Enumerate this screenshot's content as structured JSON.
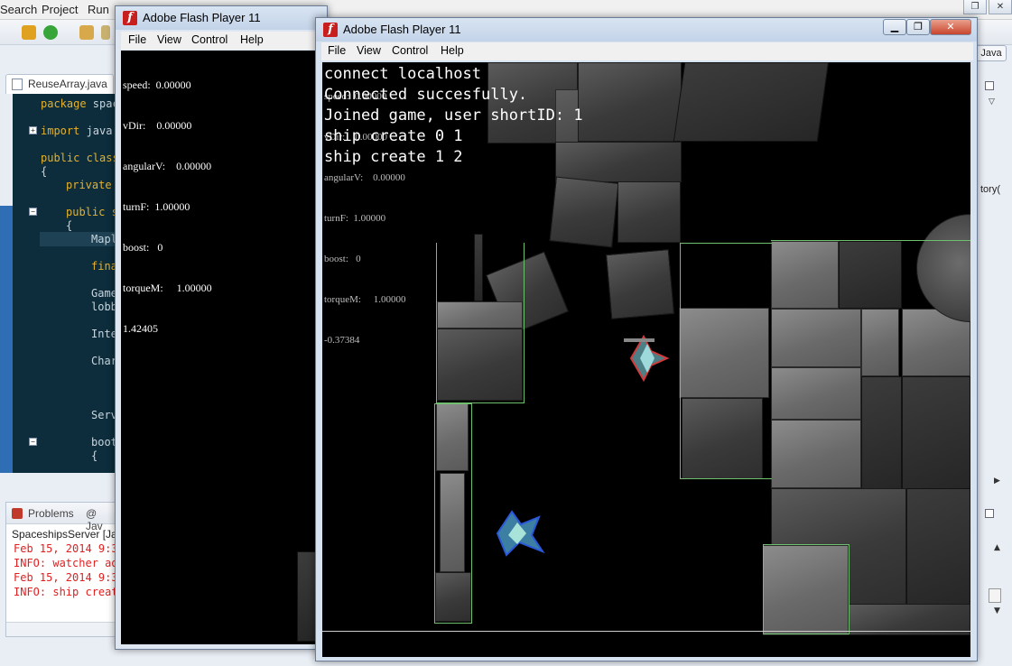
{
  "ide": {
    "menu": [
      "Search",
      "Project",
      "Run"
    ],
    "editor_tab": "ReuseArray.java",
    "perspective": "Java",
    "code_lines": [
      {
        "kw": "package",
        "text": " spac"
      },
      {
        "kw": "import",
        "text": " java."
      },
      {
        "kw": "public class",
        "text": ""
      },
      {
        "kw": "",
        "text": "{"
      },
      {
        "kw": "private",
        "text": ""
      },
      {
        "kw": "public s",
        "text": ""
      },
      {
        "kw": "",
        "text": "{"
      },
      {
        "kw": "",
        "text": "Mapl"
      },
      {
        "kw": "fina",
        "text": ""
      },
      {
        "kw": "",
        "text": "Game"
      },
      {
        "kw": "",
        "text": "lobb"
      },
      {
        "kw": "",
        "text": "Inte"
      },
      {
        "kw": "",
        "text": "Char"
      },
      {
        "kw": "",
        "text": "Serv"
      },
      {
        "kw": "",
        "text": "boot"
      },
      {
        "kw": "",
        "text": "{"
      }
    ],
    "console_tabs": [
      "Problems",
      "@ Jav"
    ],
    "console_title": "SpaceshipsServer [Jav",
    "console_lines": [
      "Feb 15, 2014 9:3",
      "INFO: watcher ad",
      "Feb 15, 2014 9:3",
      "INFO: ship creat"
    ],
    "right_fragment": "tory("
  },
  "flash_back": {
    "title": "Adobe Flash Player 11",
    "menu": [
      "File",
      "View",
      "Control",
      "Help"
    ],
    "stats": [
      {
        "label": "speed:",
        "value": "0.00000"
      },
      {
        "label": "vDir:",
        "value": "0.00000"
      },
      {
        "label": "angularV:",
        "value": "0.00000"
      },
      {
        "label": "turnF:",
        "value": "1.00000"
      },
      {
        "label": "boost:",
        "value": "0"
      },
      {
        "label": "torqueM:",
        "value": "1.00000"
      }
    ],
    "extra": "1.42405"
  },
  "flash_front": {
    "title": "Adobe Flash Player 11",
    "menu": [
      "File",
      "View",
      "Control",
      "Help"
    ],
    "stats": [
      {
        "label": "speed:",
        "value": "0.00000"
      },
      {
        "label": "vDir:",
        "value": "0.00000"
      },
      {
        "label": "angularV:",
        "value": "0.00000"
      },
      {
        "label": "turnF:",
        "value": "1.00000"
      },
      {
        "label": "boost:",
        "value": "0"
      },
      {
        "label": "torqueM:",
        "value": "1.00000"
      }
    ],
    "extra": "-0.37384",
    "console": [
      "connect localhost",
      "Connected succesfully.",
      "Joined game, user shortID: 1",
      "ship create 0 1",
      "ship create 1 2"
    ]
  },
  "colors": {
    "code_bg": "#0d2d3c",
    "keyword": "#e4b12c",
    "console_error": "#e02020",
    "flash_red": "#c81e1e",
    "collision_edge": "#6fbf6f"
  }
}
